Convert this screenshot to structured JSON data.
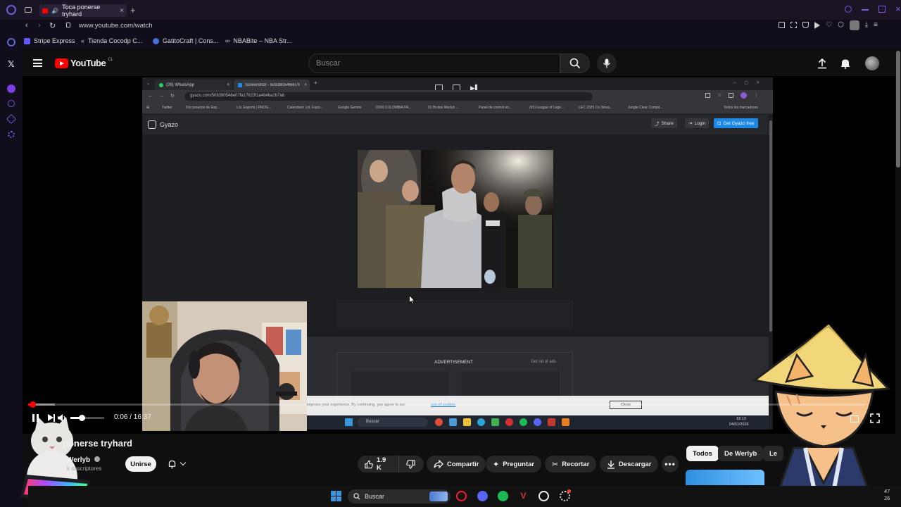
{
  "browser": {
    "active_tab_title": "Toca ponerse tryhard",
    "url": "www.youtube.com/watch",
    "bookmarks": [
      {
        "label": "Stripe Express"
      },
      {
        "label": "Tienda Cocodp C..."
      },
      {
        "label": "GatitoCraft | Cons..."
      },
      {
        "label": "NBABite – NBA Str..."
      }
    ]
  },
  "youtube": {
    "logo_text": "YouTube",
    "country_code": "CL",
    "search_placeholder": "Buscar"
  },
  "stream_screen": {
    "tabs": [
      {
        "label": "(26) WhatsApp"
      },
      {
        "label": "Screenshot - 509390546e07fa1"
      }
    ],
    "url": "gyazo.com/509390546e07fa17623f1a4646a2b7a6",
    "bookmarks": [
      {
        "label": "Twitter"
      },
      {
        "label": "Diccionarios de Esp..."
      },
      {
        "label": "LoL Esports | PROG..."
      },
      {
        "label": "Calendario LoL Espo..."
      },
      {
        "label": "Google Gemini"
      },
      {
        "label": "DON COLOMBIA PA..."
      },
      {
        "label": "01 Brutos Werlyb ..."
      },
      {
        "label": "Panel de control en..."
      },
      {
        "label": "(65) League of Lege..."
      },
      {
        "label": "LEC 2025 Co-Strea..."
      },
      {
        "label": "Jungle Clear Compil..."
      },
      {
        "label": "Todos los marcadores"
      }
    ],
    "gyazo_logo": "Gyazo",
    "share_label": "Share",
    "login_label": "Login",
    "get_free_label": "Get Gyazo free",
    "ad_label": "ADVERTISEMENT",
    "rid_ads_label": "Get rid of ads",
    "cookie_text": "improve your experience. By continuing, you agree to our",
    "cookie_link": "use of cookies",
    "close_label": "Close",
    "taskbar_search": "Buscar",
    "clock_time": "18:13",
    "clock_date": "04/01/2026"
  },
  "player": {
    "time_display": "0:06 / 16:37",
    "progress_fraction": 0.005
  },
  "video": {
    "title_visible": "ponerse tryhard",
    "channel_name": "Werlyb",
    "subscribers": "k suscriptores",
    "join_label": "Unirse",
    "likes": "1.9 K",
    "share_label": "Compartir",
    "ask_label": "Preguntar",
    "clip_label": "Recortar",
    "download_label": "Descargar"
  },
  "chips": [
    {
      "label": "Todos"
    },
    {
      "label": "De Werlyb"
    },
    {
      "label": "Le"
    }
  ],
  "os_taskbar": {
    "search_label": "Buscar",
    "clock_line1": "47",
    "clock_line2": "26"
  },
  "colors": {
    "youtube_red": "#ff0000",
    "opera_red": "#ff1b2d",
    "gyazo_blue": "#1e88e5",
    "background": "#0f0f0f"
  }
}
